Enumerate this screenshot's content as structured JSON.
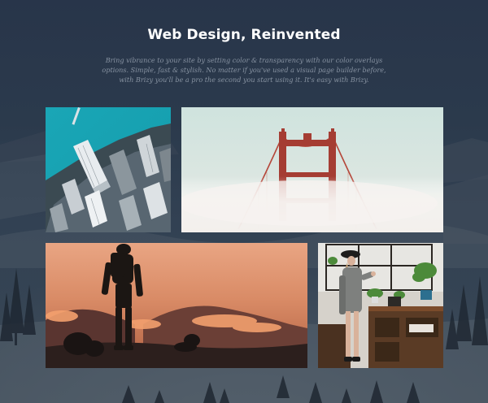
{
  "hero": {
    "title": "Web Design, Reinvented",
    "description": "Bring vibrance to your site by setting color & transparency with our color overlays options. Simple, fast & stylish. No matter if you've used a visual page builder before, with Brizy you'll be a pro the second you start using it. It's easy with Brizy."
  },
  "gallery": {
    "images": [
      {
        "subject": "aerial view of city skyscrapers beside turquoise water"
      },
      {
        "subject": "red suspension bridge tower rising above fog"
      },
      {
        "subject": "hiker silhouette at orange sunset over hills"
      },
      {
        "subject": "woman in hat standing beside shelves with plants"
      }
    ]
  },
  "colors": {
    "overlay": "#2b3a4c",
    "title_text": "#ffffff",
    "description_text": "#8792a1"
  }
}
